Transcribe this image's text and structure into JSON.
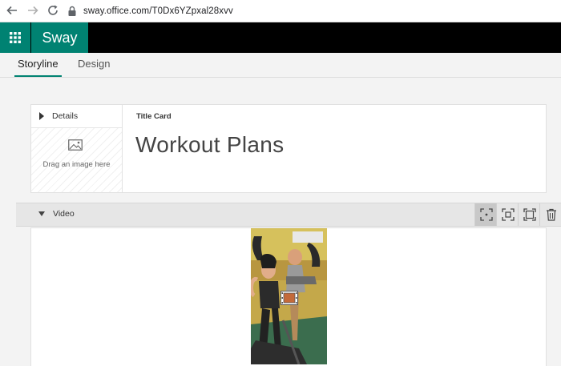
{
  "browser": {
    "url": "sway.office.com/T0Dx6YZpxal28xvv",
    "icons": [
      "back-icon",
      "forward-icon",
      "reload-icon",
      "lock-icon"
    ]
  },
  "app": {
    "name": "Sway",
    "accent_color": "#008272"
  },
  "tabs": [
    {
      "label": "Storyline",
      "active": true
    },
    {
      "label": "Design",
      "active": false
    }
  ],
  "title_card": {
    "details_label": "Details",
    "drop_text": "Drag an image here",
    "card_type": "Title Card",
    "title": "Workout Plans"
  },
  "video_section": {
    "label": "Video",
    "tools": [
      "focus-point-icon",
      "emphasize-icon",
      "fit-icon",
      "delete-icon"
    ]
  }
}
